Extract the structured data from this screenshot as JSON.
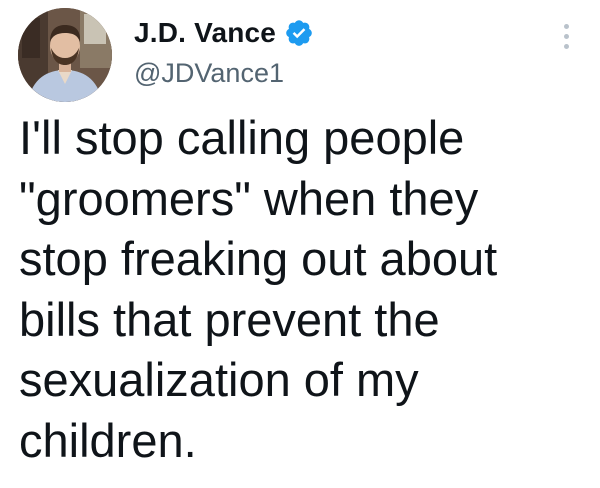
{
  "author": {
    "display_name": "J.D. Vance",
    "handle": "@JDVance1",
    "verified": true,
    "verified_color": "#1d9bf0"
  },
  "tweet": {
    "lines": [
      "I'll stop calling people",
      "\"groomers\" when they",
      "stop freaking out about",
      "bills that prevent the",
      "sexualization of my",
      "children."
    ]
  },
  "icons": {
    "more": "more-vertical-icon",
    "verified": "verified-badge-icon",
    "avatar": "profile-photo"
  }
}
